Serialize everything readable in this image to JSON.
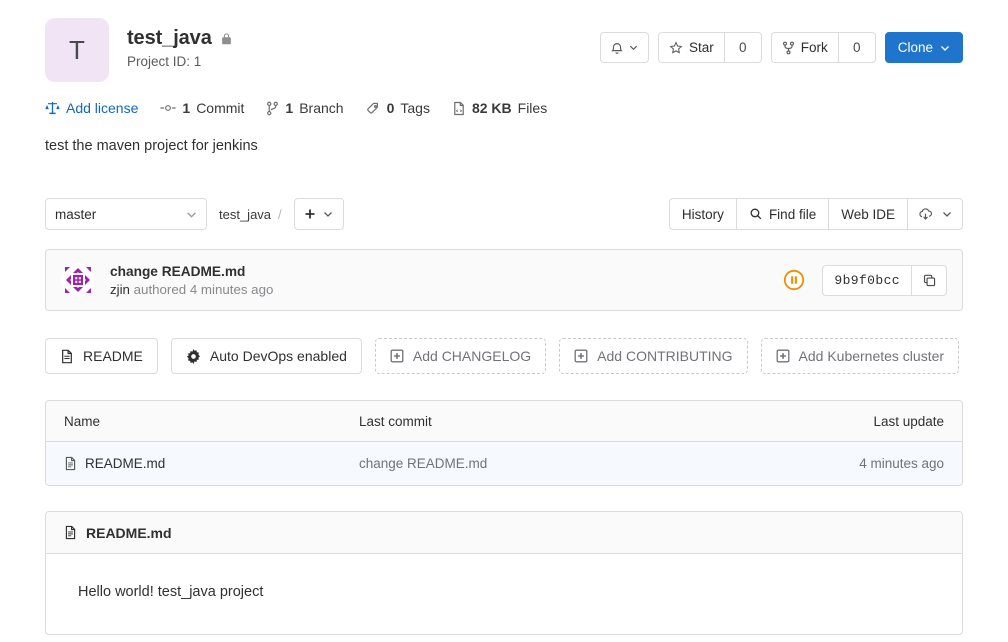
{
  "project": {
    "avatar_initial": "T",
    "name": "test_java",
    "visibility_icon": "lock-icon",
    "project_id_label": "Project ID: 1",
    "description": "test the maven project for jenkins"
  },
  "header_actions": {
    "notifications_icon": "bell-icon",
    "notifications_caret_icon": "chevron-down-icon",
    "star_icon": "star-icon",
    "star_label": "Star",
    "star_count": "0",
    "fork_icon": "fork-icon",
    "fork_label": "Fork",
    "fork_count": "0",
    "clone_label": "Clone",
    "clone_caret_icon": "chevron-down-icon",
    "clone_color": "#1f75cb"
  },
  "stats": [
    {
      "icon": "scale-icon",
      "label": "Add license",
      "value": "",
      "link": true
    },
    {
      "icon": "commit-icon",
      "value": "1",
      "label": "Commit",
      "link": false
    },
    {
      "icon": "branch-icon",
      "value": "1",
      "label": "Branch",
      "link": false
    },
    {
      "icon": "tag-icon",
      "value": "0",
      "label": "Tags",
      "link": false
    },
    {
      "icon": "file-size-icon",
      "value": "82 KB",
      "label": "Files",
      "link": false
    }
  ],
  "toolbar": {
    "branch": "master",
    "branch_caret_icon": "chevron-down-icon",
    "breadcrumb_root": "test_java",
    "breadcrumb_sep": "/",
    "add_icon": "plus-icon",
    "add_caret_icon": "chevron-down-icon",
    "history_label": "History",
    "find_file_icon": "search-icon",
    "find_file_label": "Find file",
    "web_ide_label": "Web IDE",
    "download_icon": "cloud-download-icon",
    "download_caret_icon": "chevron-down-icon"
  },
  "last_commit": {
    "avatar_icon": "identicon-avatar",
    "title": "change README.md",
    "author": "zjin",
    "meta": "authored 4 minutes ago",
    "pipeline_status_icon": "pipeline-paused-icon",
    "pipeline_status_color": "#ef8e00",
    "sha": "9b9f0bcc",
    "copy_icon": "copy-icon"
  },
  "quick_actions": [
    {
      "icon": "doc-icon",
      "label": "README",
      "dashed": false
    },
    {
      "icon": "gear-icon",
      "label": "Auto DevOps enabled",
      "dashed": false
    },
    {
      "icon": "plus-square-icon",
      "label": "Add CHANGELOG",
      "dashed": true
    },
    {
      "icon": "plus-square-icon",
      "label": "Add CONTRIBUTING",
      "dashed": true
    },
    {
      "icon": "plus-square-icon",
      "label": "Add Kubernetes cluster",
      "dashed": true
    }
  ],
  "files_table": {
    "columns": [
      "Name",
      "Last commit",
      "Last update"
    ],
    "rows": [
      {
        "icon": "file-icon",
        "name": "README.md",
        "last_commit": "change README.md",
        "last_update": "4 minutes ago"
      }
    ]
  },
  "readme": {
    "icon": "file-icon",
    "title": "README.md",
    "body": "Hello world! test_java project"
  }
}
